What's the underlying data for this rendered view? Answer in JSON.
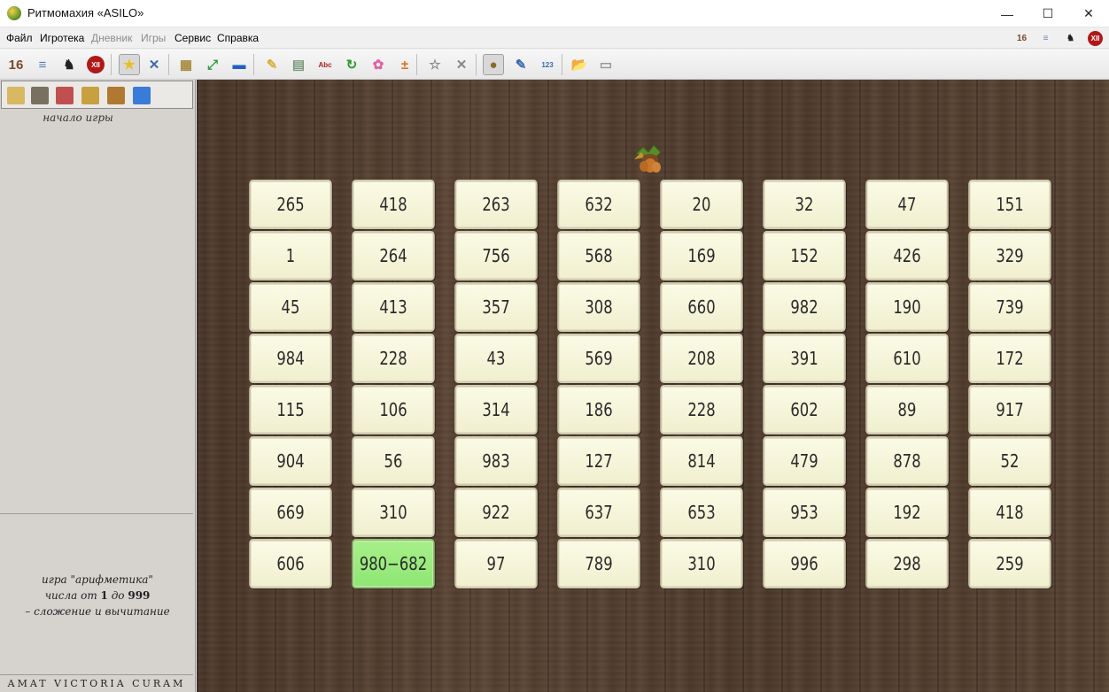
{
  "window": {
    "title": "Ритмомахия «ASILO»",
    "controls": {
      "minimize": "—",
      "maximize": "☐",
      "close": "✕"
    }
  },
  "menu": {
    "items": [
      {
        "label": "Файл",
        "enabled": true
      },
      {
        "label": "Игротека",
        "enabled": true
      },
      {
        "label": "Дневник",
        "enabled": false
      },
      {
        "label": "Игры",
        "enabled": false
      },
      {
        "label": "Сервис",
        "enabled": true
      },
      {
        "label": "Справка",
        "enabled": true
      }
    ],
    "right_icons": [
      {
        "name": "clock-icon",
        "glyph": "16",
        "color": "#7a4a2a"
      },
      {
        "name": "scroll-icon",
        "glyph": "≡",
        "color": "#6a8ab8"
      },
      {
        "name": "knight-icon",
        "glyph": "♞",
        "color": "#222222"
      },
      {
        "name": "roman-twelve-icon",
        "glyph": "XII",
        "color": "#b01818"
      }
    ]
  },
  "toolbar": {
    "buttons": [
      {
        "name": "clock-icon",
        "glyph": "16",
        "color": "#7a4a2a"
      },
      {
        "name": "scroll-icon",
        "glyph": "≡",
        "color": "#5a80b8"
      },
      {
        "name": "knight-icon",
        "glyph": "♞",
        "color": "#222222"
      },
      {
        "name": "roman-twelve-icon",
        "glyph": "XII",
        "color": "#b01818"
      },
      {
        "name": "star-icon",
        "glyph": "★",
        "color": "#e8c020"
      },
      {
        "name": "tools-icon",
        "glyph": "✕",
        "color": "#3a6ab0"
      },
      {
        "name": "board-icon",
        "glyph": "▦",
        "color": "#a88a40"
      },
      {
        "name": "fullscreen-icon",
        "glyph": "⤢",
        "color": "#2a9a3a"
      },
      {
        "name": "window-icon",
        "glyph": "▬",
        "color": "#2060c0"
      },
      {
        "name": "new-document-icon",
        "glyph": "✎",
        "color": "#d8b040"
      },
      {
        "name": "table-icon",
        "glyph": "▤",
        "color": "#7a9a7a"
      },
      {
        "name": "book-icon",
        "glyph": "Abc",
        "color": "#b02020"
      },
      {
        "name": "refresh-icon",
        "glyph": "↻",
        "color": "#2a9a2a"
      },
      {
        "name": "flower-icon",
        "glyph": "✿",
        "color": "#e060a0"
      },
      {
        "name": "calculator-icon",
        "glyph": "±",
        "color": "#e07020"
      },
      {
        "name": "star-outline-icon",
        "glyph": "☆",
        "color": "#888888"
      },
      {
        "name": "cross-icon",
        "glyph": "✕",
        "color": "#888888"
      },
      {
        "name": "acorn-icon",
        "glyph": "●",
        "color": "#8a6a2a"
      },
      {
        "name": "pencil-icon",
        "glyph": "✎",
        "color": "#3a6ab0"
      },
      {
        "name": "numbers-icon",
        "glyph": "123",
        "color": "#3a6ab0"
      },
      {
        "name": "open-folder-icon",
        "glyph": "📂",
        "color": "#999999"
      },
      {
        "name": "save-icon",
        "glyph": "▭",
        "color": "#999999"
      }
    ]
  },
  "left_panel": {
    "tabs": [
      {
        "name": "scroll-tab-icon",
        "color": "#d8b860"
      },
      {
        "name": "grid-tab-icon",
        "color": "#7a7060"
      },
      {
        "name": "calculator-tab-icon",
        "color": "#c05050"
      },
      {
        "name": "crown-tab-icon",
        "color": "#c8a040"
      },
      {
        "name": "rook-tab-icon",
        "color": "#b07830"
      },
      {
        "name": "bar-chart-tab-icon",
        "color": "#3a7ad8"
      }
    ],
    "log_header": "начало игры",
    "game_info": {
      "line1": "игра \"арифметика\"",
      "line2_prefix": "числа от ",
      "line2_from": "1",
      "line2_mid": " до ",
      "line2_to": "999",
      "line3": "– сложение и вычитание"
    },
    "motto": "AMAT VICTORIA CURAM"
  },
  "board": {
    "rows": [
      [
        "265",
        "418",
        "263",
        "632",
        "20",
        "32",
        "47",
        "151"
      ],
      [
        "1",
        "264",
        "756",
        "568",
        "169",
        "152",
        "426",
        "329"
      ],
      [
        "45",
        "413",
        "357",
        "308",
        "660",
        "982",
        "190",
        "739"
      ],
      [
        "984",
        "228",
        "43",
        "569",
        "208",
        "391",
        "610",
        "172"
      ],
      [
        "115",
        "106",
        "314",
        "186",
        "228",
        "602",
        "89",
        "917"
      ],
      [
        "904",
        "56",
        "983",
        "127",
        "814",
        "479",
        "878",
        "52"
      ],
      [
        "669",
        "310",
        "922",
        "637",
        "653",
        "953",
        "192",
        "418"
      ],
      [
        "606",
        "980−682",
        "97",
        "789",
        "310",
        "996",
        "298",
        "259"
      ]
    ],
    "active_cell": {
      "row": 7,
      "col": 1
    },
    "active_color": "#9aec7e",
    "token": "acorn-icon"
  }
}
